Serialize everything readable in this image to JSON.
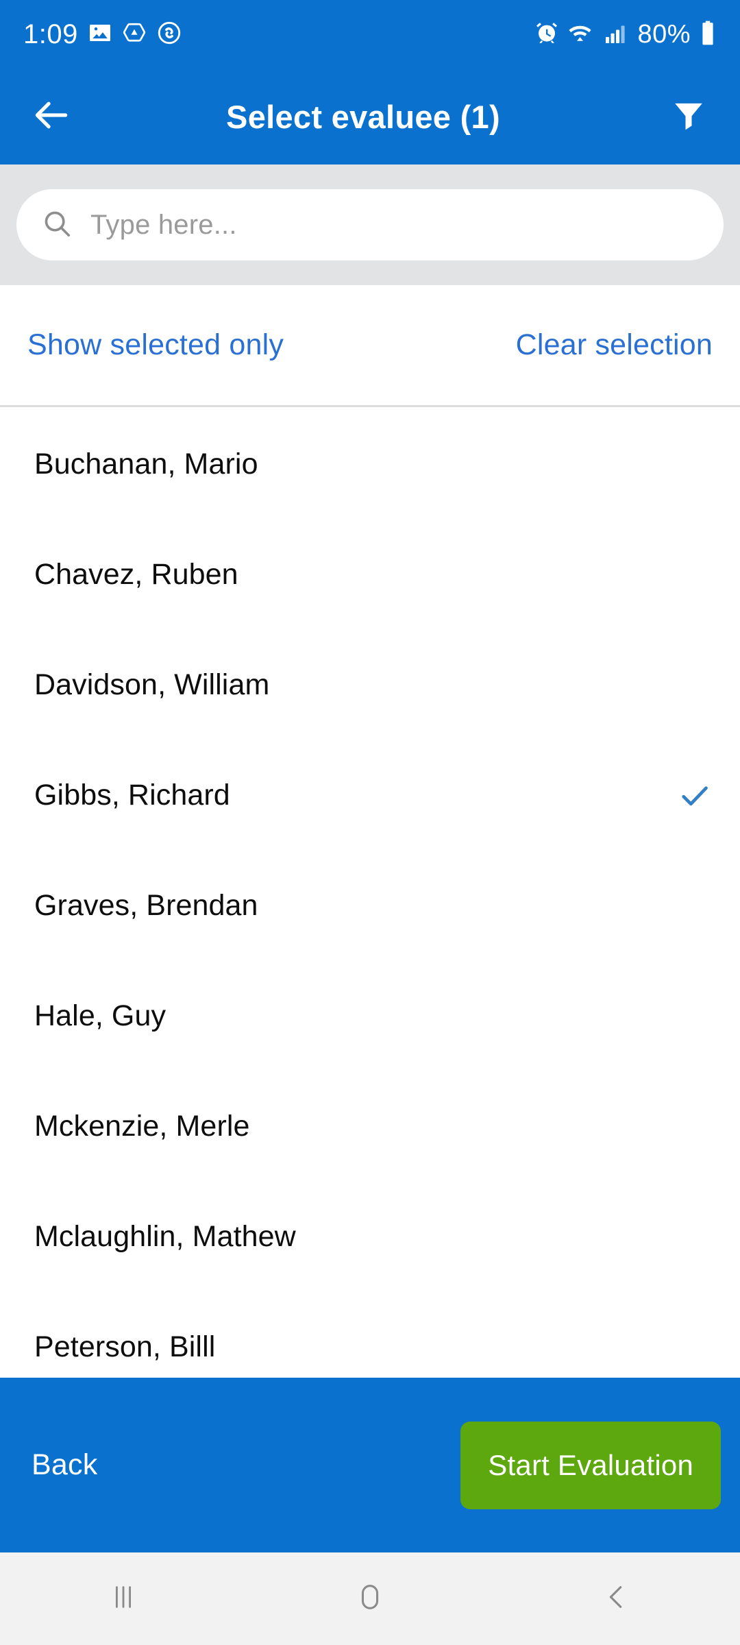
{
  "status_bar": {
    "time": "1:09",
    "battery_percent": "80%",
    "left_icons": [
      "gallery-icon",
      "drive-icon",
      "shazam-icon"
    ],
    "right_icons": [
      "alarm-icon",
      "wifi-icon",
      "signal-icon",
      "battery-icon"
    ],
    "background_color": "#0A72CE"
  },
  "app_bar": {
    "back_icon": "back-arrow-icon",
    "title": "Select evaluee (1)",
    "filter_icon": "filter-icon",
    "background_color": "#0A72CE"
  },
  "search": {
    "icon": "search-icon",
    "placeholder": "Type here...",
    "value": "",
    "background_color": "#E2E3E5"
  },
  "actions": {
    "show_selected_label": "Show selected only",
    "clear_selection_label": "Clear selection",
    "link_color": "#2A6FD4"
  },
  "list": {
    "check_icon": "check-icon",
    "check_color": "#3480C4",
    "items": [
      {
        "name": "Buchanan, Mario",
        "selected": false
      },
      {
        "name": "Chavez, Ruben",
        "selected": false
      },
      {
        "name": "Davidson, William",
        "selected": false
      },
      {
        "name": "Gibbs, Richard",
        "selected": true
      },
      {
        "name": "Graves, Brendan",
        "selected": false
      },
      {
        "name": "Hale, Guy",
        "selected": false
      },
      {
        "name": "Mckenzie, Merle",
        "selected": false
      },
      {
        "name": "Mclaughlin, Mathew",
        "selected": false
      },
      {
        "name": "Peterson, Billl",
        "selected": false
      }
    ]
  },
  "bottom_bar": {
    "back_label": "Back",
    "start_label": "Start Evaluation",
    "background_color": "#0A72CE",
    "start_button_color": "#5EA80F"
  },
  "nav_bar": {
    "recents_icon": "recents-icon",
    "home_icon": "home-icon",
    "back_icon": "nav-back-icon",
    "background_color": "#F2F2F2"
  }
}
